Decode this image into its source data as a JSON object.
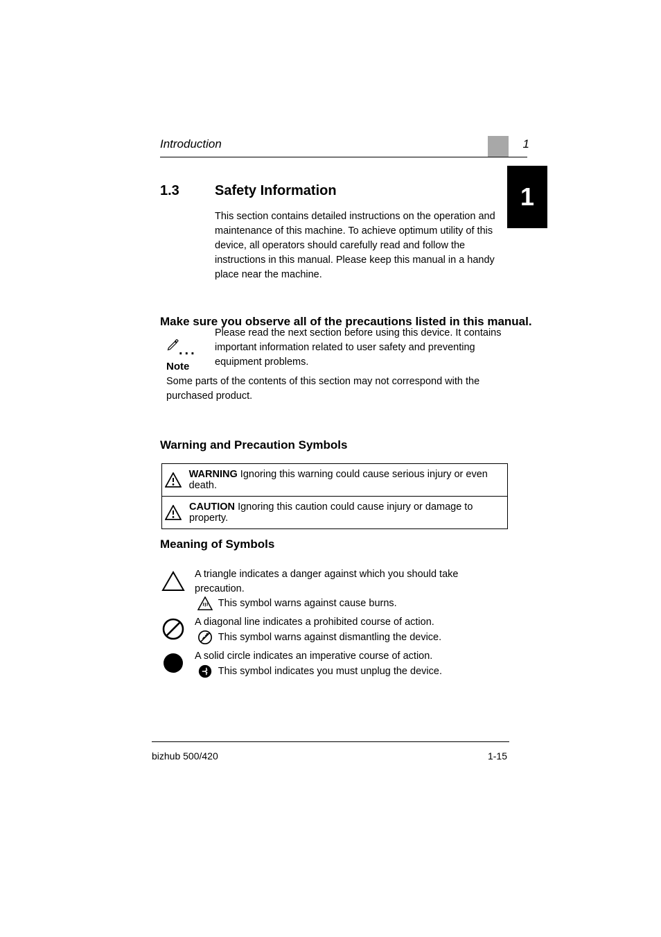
{
  "header": {
    "left": "Introduction",
    "right": "1",
    "chapter_badge": "1"
  },
  "section": {
    "number": "1.3",
    "title": "Safety Information",
    "body": "This section contains detailed instructions on the operation and maintenance of this machine. To achieve optimum utility of this device, all operators should carefully read and follow the instructions in this manual. Please keep this manual in a handy place near the machine.\n\nPlease read the next section before using this device. It contains important information related to user safety and preventing equipment problems."
  },
  "subsections": {
    "s1": "Make sure you observe all of the precautions listed in this manual.",
    "s2": "Warning and Precaution Symbols",
    "s3": "Meaning of Symbols"
  },
  "tip": {
    "title": "Note",
    "body": "Some parts of the contents of this section may not correspond with the purchased product."
  },
  "table": {
    "rows": [
      {
        "label": "WARNING",
        "text": "Ignoring this warning could cause serious injury or even death."
      },
      {
        "label": "CAUTION",
        "text": "Ignoring this caution could cause injury or damage to property."
      }
    ]
  },
  "symbols": [
    {
      "shape": "triangle-outline",
      "text_before": "A triangle indicates a danger against which you should take precaution.",
      "example": "triangle-heat",
      "text_after": "This symbol warns against cause burns."
    },
    {
      "shape": "prohibit",
      "text_before": "A diagonal line indicates a prohibited course of action.",
      "example": "prohibit-disassemble",
      "text_after": "This symbol warns against dismantling the device."
    },
    {
      "shape": "solid-circle",
      "text_before": "A solid circle indicates an imperative course of action.",
      "example": "unplug",
      "text_after": "This symbol indicates you must unplug the device."
    }
  ],
  "footer": {
    "left": "bizhub 500/420",
    "right": "1-15"
  }
}
